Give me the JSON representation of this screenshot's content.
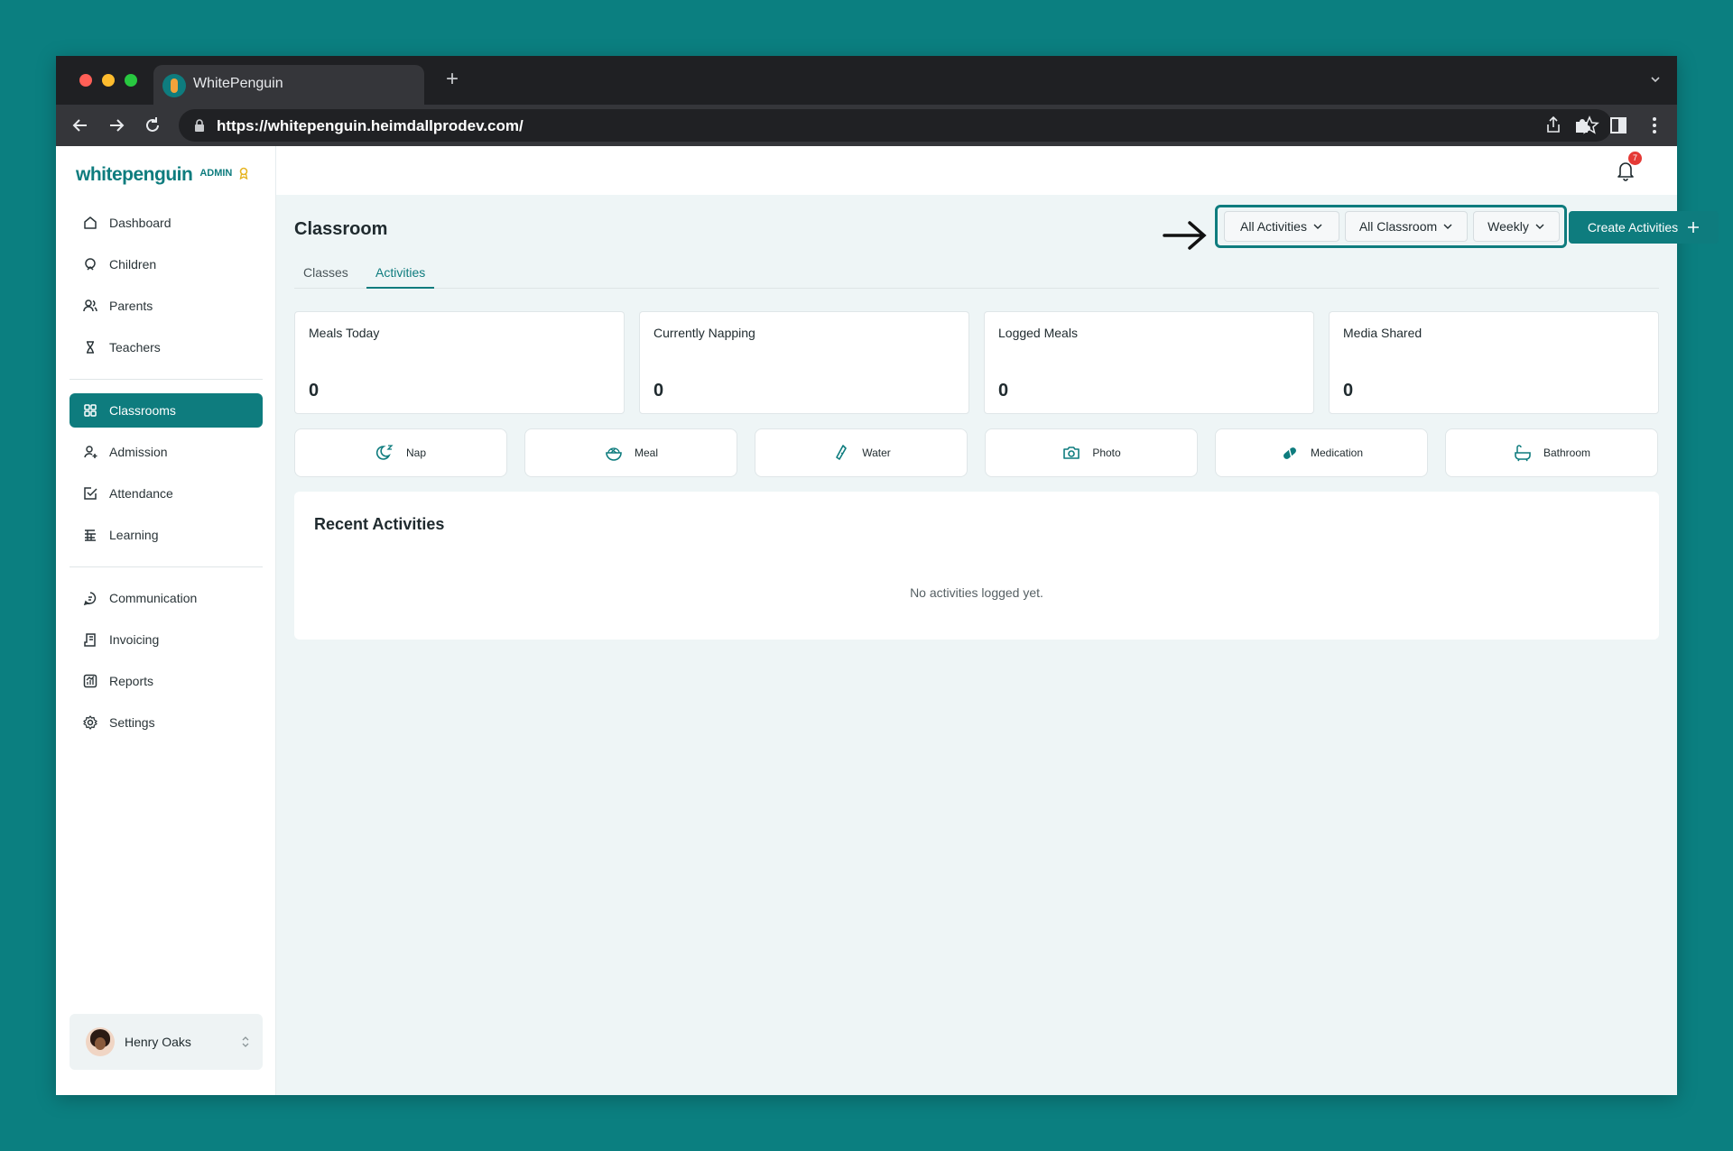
{
  "browser": {
    "tab_title": "WhitePenguin",
    "url": "https://whitepenguin.heimdallprodev.com/"
  },
  "brand": {
    "name": "whitepenguin",
    "role": "ADMIN"
  },
  "sidebar": {
    "items": [
      {
        "label": "Dashboard",
        "icon": "home-icon"
      },
      {
        "label": "Children",
        "icon": "child-icon"
      },
      {
        "label": "Parents",
        "icon": "users-icon"
      },
      {
        "label": "Teachers",
        "icon": "teacher-icon"
      },
      {
        "label": "Classrooms",
        "icon": "grid-icon",
        "active": true
      },
      {
        "label": "Admission",
        "icon": "user-add-icon"
      },
      {
        "label": "Attendance",
        "icon": "checkbox-icon"
      },
      {
        "label": "Learning",
        "icon": "book-icon"
      },
      {
        "label": "Communication",
        "icon": "chat-icon"
      },
      {
        "label": "Invoicing",
        "icon": "invoice-icon"
      },
      {
        "label": "Reports",
        "icon": "chart-icon"
      },
      {
        "label": "Settings",
        "icon": "gear-icon"
      }
    ]
  },
  "user": {
    "name": "Henry Oaks"
  },
  "notifications": {
    "count": "7"
  },
  "page": {
    "title": "Classroom",
    "filters": {
      "activities": "All Activities",
      "classroom": "All Classroom",
      "period": "Weekly"
    },
    "create_label": "Create Activities",
    "tabs": [
      {
        "label": "Classes",
        "active": false
      },
      {
        "label": "Activities",
        "active": true
      }
    ],
    "stats": [
      {
        "label": "Meals Today",
        "value": "0"
      },
      {
        "label": "Currently Napping",
        "value": "0"
      },
      {
        "label": "Logged Meals",
        "value": "0"
      },
      {
        "label": "Media Shared",
        "value": "0"
      }
    ],
    "actions": [
      {
        "label": "Nap",
        "icon": "moon-icon"
      },
      {
        "label": "Meal",
        "icon": "bowl-icon"
      },
      {
        "label": "Water",
        "icon": "bottle-icon"
      },
      {
        "label": "Photo",
        "icon": "camera-icon"
      },
      {
        "label": "Medication",
        "icon": "pill-icon"
      },
      {
        "label": "Bathroom",
        "icon": "bathtub-icon"
      }
    ],
    "recent": {
      "title": "Recent Activities",
      "empty_message": "No activities logged yet."
    }
  },
  "colors": {
    "brand": "#0e7c7e",
    "background": "#0b7f80",
    "app_bg": "#eef5f6",
    "badge": "#e53935"
  }
}
